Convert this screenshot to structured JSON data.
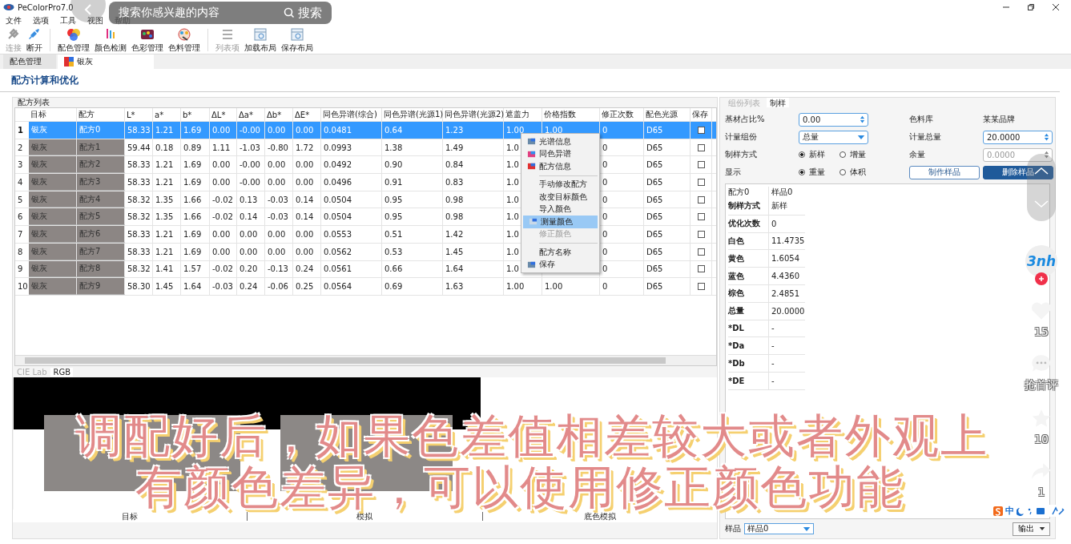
{
  "window": {
    "title": "PeColorPro7.0"
  },
  "menu": [
    "文件",
    "选项",
    "工具",
    "视图",
    "帮助"
  ],
  "toolbar": [
    {
      "label": "连接",
      "disabled": true
    },
    {
      "label": "断开",
      "disabled": false
    },
    {
      "label": "配色管理",
      "disabled": false
    },
    {
      "label": "颜色检测",
      "disabled": false
    },
    {
      "label": "色彩管理",
      "disabled": false
    },
    {
      "label": "色料管理",
      "disabled": false
    },
    {
      "label": "列表项",
      "disabled": true
    },
    {
      "label": "加载布局",
      "disabled": false
    },
    {
      "label": "保存布局",
      "disabled": false
    }
  ],
  "doc_tabs": [
    {
      "label": "配色管理",
      "selected": false
    },
    {
      "label": "银灰",
      "selected": true
    }
  ],
  "section_title": "配方计算和优化",
  "formula_list": {
    "title": "配方列表",
    "columns": [
      "目标",
      "配方",
      "L*",
      "a*",
      "b*",
      "ΔL*",
      "Δa*",
      "Δb*",
      "ΔE*",
      "同色异谱(综合)",
      "同色异谱(光源1)",
      "同色异谱(光源2)",
      "遮盖力",
      "价格指数",
      "修正次数",
      "配色光源",
      "保存"
    ],
    "rows": [
      {
        "index": "1",
        "selected": true,
        "saved": false,
        "cells": [
          "银灰",
          "配方0",
          "58.33",
          "1.21",
          "1.69",
          "0.00",
          "-0.00",
          "0.00",
          "0.00",
          "0.0481",
          "0.64",
          "1.23",
          "1.00",
          "1.00",
          "0",
          "D65"
        ]
      },
      {
        "index": "2",
        "selected": false,
        "saved": false,
        "cells": [
          "银灰",
          "配方1",
          "59.44",
          "0.18",
          "0.89",
          "1.11",
          "-1.03",
          "-0.80",
          "1.72",
          "0.0993",
          "1.38",
          "1.49",
          "1.0",
          null,
          "0",
          "D65"
        ]
      },
      {
        "index": "3",
        "selected": false,
        "saved": false,
        "cells": [
          "银灰",
          "配方2",
          "58.33",
          "1.21",
          "1.69",
          "0.00",
          "-0.00",
          "0.00",
          "0.00",
          "0.0492",
          "0.90",
          "0.84",
          "1.0",
          null,
          "0",
          "D65"
        ]
      },
      {
        "index": "4",
        "selected": false,
        "saved": false,
        "cells": [
          "银灰",
          "配方3",
          "58.33",
          "1.21",
          "1.69",
          "0.00",
          "-0.00",
          "0.00",
          "0.00",
          "0.0496",
          "0.91",
          "0.83",
          "1.0",
          null,
          "0",
          "D65"
        ]
      },
      {
        "index": "5",
        "selected": false,
        "saved": false,
        "cells": [
          "银灰",
          "配方4",
          "58.32",
          "1.35",
          "1.66",
          "-0.02",
          "0.13",
          "-0.03",
          "0.14",
          "0.0504",
          "0.95",
          "0.98",
          "1.0",
          null,
          "0",
          "D65"
        ]
      },
      {
        "index": "6",
        "selected": false,
        "saved": false,
        "cells": [
          "银灰",
          "配方5",
          "58.32",
          "1.35",
          "1.66",
          "-0.02",
          "0.14",
          "-0.03",
          "0.14",
          "0.0504",
          "0.95",
          "0.98",
          "1.0",
          null,
          "0",
          "D65"
        ]
      },
      {
        "index": "7",
        "selected": false,
        "saved": false,
        "cells": [
          "银灰",
          "配方6",
          "58.33",
          "1.21",
          "1.69",
          "0.00",
          "0.00",
          "0.00",
          "0.00",
          "0.0553",
          "0.51",
          "1.42",
          "1.0",
          null,
          "0",
          "D65"
        ]
      },
      {
        "index": "8",
        "selected": false,
        "saved": false,
        "cells": [
          "银灰",
          "配方7",
          "58.33",
          "1.21",
          "1.69",
          "0.00",
          "0.00",
          "0.00",
          "0.00",
          "0.0562",
          "0.53",
          "1.45",
          "1.0",
          null,
          "0",
          "D65"
        ]
      },
      {
        "index": "9",
        "selected": false,
        "saved": false,
        "cells": [
          "银灰",
          "配方8",
          "58.32",
          "1.41",
          "1.57",
          "-0.02",
          "0.20",
          "-0.13",
          "0.24",
          "0.0561",
          "0.66",
          "1.64",
          "1.0",
          null,
          "0",
          "D65"
        ]
      },
      {
        "index": "10",
        "selected": false,
        "saved": false,
        "cells": [
          "银灰",
          "配方9",
          "58.30",
          "1.45",
          "1.64",
          "-0.03",
          "0.24",
          "-0.06",
          "0.25",
          "0.0564",
          "0.69",
          "1.63",
          "1.00",
          "1.00",
          "0",
          "D65"
        ]
      }
    ]
  },
  "context_menu": [
    {
      "kind": "item",
      "label": "光谱信息",
      "icon": true,
      "highlighted": false,
      "disabled": false
    },
    {
      "kind": "item",
      "label": "同色异谱",
      "icon": true,
      "highlighted": false,
      "disabled": false
    },
    {
      "kind": "item",
      "label": "配方信息",
      "icon": true,
      "highlighted": false,
      "disabled": false
    },
    {
      "kind": "separator"
    },
    {
      "kind": "item",
      "label": "手动修改配方",
      "icon": false,
      "highlighted": false,
      "disabled": false
    },
    {
      "kind": "item",
      "label": "改变目标颜色",
      "icon": false,
      "highlighted": false,
      "disabled": false
    },
    {
      "kind": "item",
      "label": "导入颜色",
      "icon": false,
      "highlighted": false,
      "disabled": false
    },
    {
      "kind": "item",
      "label": "测量颜色",
      "icon": true,
      "highlighted": true,
      "disabled": false
    },
    {
      "kind": "item",
      "label": "修正颜色",
      "icon": false,
      "highlighted": false,
      "disabled": true
    },
    {
      "kind": "separator"
    },
    {
      "kind": "item",
      "label": "配方名称",
      "icon": false,
      "highlighted": false,
      "disabled": false
    },
    {
      "kind": "item",
      "label": "保存",
      "icon": true,
      "highlighted": false,
      "disabled": false
    }
  ],
  "color_tabs": [
    {
      "label": "CIE Lab",
      "selected": false
    },
    {
      "label": "RGB",
      "selected": true
    }
  ],
  "swatch_labels": [
    "目标",
    "模拟",
    "底色模拟"
  ],
  "side_tabs": [
    {
      "label": "组份列表",
      "selected": false
    },
    {
      "label": "制样",
      "selected": true
    }
  ],
  "sampling_form": [
    {
      "kind": "label",
      "text": "基材占比%"
    },
    {
      "kind": "spin",
      "value": "0.00",
      "disabled": false
    },
    {
      "kind": "label",
      "text": "色料库"
    },
    {
      "kind": "text",
      "text": "某某品牌"
    },
    {
      "kind": "label",
      "text": "计量组份"
    },
    {
      "kind": "dropdown",
      "value": "总量"
    },
    {
      "kind": "label",
      "text": "计量总量"
    },
    {
      "kind": "spin",
      "value": "20.0000",
      "disabled": false
    },
    {
      "kind": "label",
      "text": "制样方式"
    },
    {
      "kind": "radios",
      "options": [
        {
          "label": "新样",
          "selected": true
        },
        {
          "label": "增量",
          "selected": false
        }
      ]
    },
    {
      "kind": "label",
      "text": "余量"
    },
    {
      "kind": "spin",
      "value": "0.0000",
      "disabled": true
    },
    {
      "kind": "label",
      "text": "显示"
    },
    {
      "kind": "radios",
      "options": [
        {
          "label": "重量",
          "selected": true
        },
        {
          "label": "体积",
          "selected": false
        }
      ]
    },
    {
      "kind": "button",
      "text": "制作样品"
    },
    {
      "kind": "primary-button",
      "text": "删除样品"
    }
  ],
  "sample_result": [
    {
      "kind": "plain",
      "key": "配方0",
      "value": "样品0"
    },
    {
      "kind": "bold",
      "key": "制样方式",
      "value": "新样"
    },
    {
      "kind": "bold",
      "key": "优化次数",
      "value": "0"
    },
    {
      "kind": "bold",
      "key": "白色",
      "value": "11.4735"
    },
    {
      "kind": "bold",
      "key": "黄色",
      "value": "1.6054"
    },
    {
      "kind": "bold",
      "key": "蓝色",
      "value": "4.4360"
    },
    {
      "kind": "bold",
      "key": "棕色",
      "value": "2.4851"
    },
    {
      "kind": "bold",
      "key": "总量",
      "value": "20.0000"
    },
    {
      "kind": "bold",
      "key": "*DL",
      "value": "-"
    },
    {
      "kind": "bold",
      "key": "*Da",
      "value": "-"
    },
    {
      "kind": "bold",
      "key": "*Db",
      "value": "-"
    },
    {
      "kind": "bold",
      "key": "*DE",
      "value": "-"
    }
  ],
  "sample_bar": {
    "label": "样品",
    "value": "样品0",
    "button": "输出"
  },
  "video_overlay": {
    "search_placeholder": "搜索你感兴趣的内容",
    "search_button": "搜索",
    "subtitle": [
      "调配好后，如果色差值相差较大或者外观上",
      "有颜色差异，可以使用修正颜色功能"
    ],
    "avatar": "3nh",
    "likes": "15",
    "comments": "抢首评",
    "favorites": "10",
    "shares": "1",
    "ime": "中"
  }
}
